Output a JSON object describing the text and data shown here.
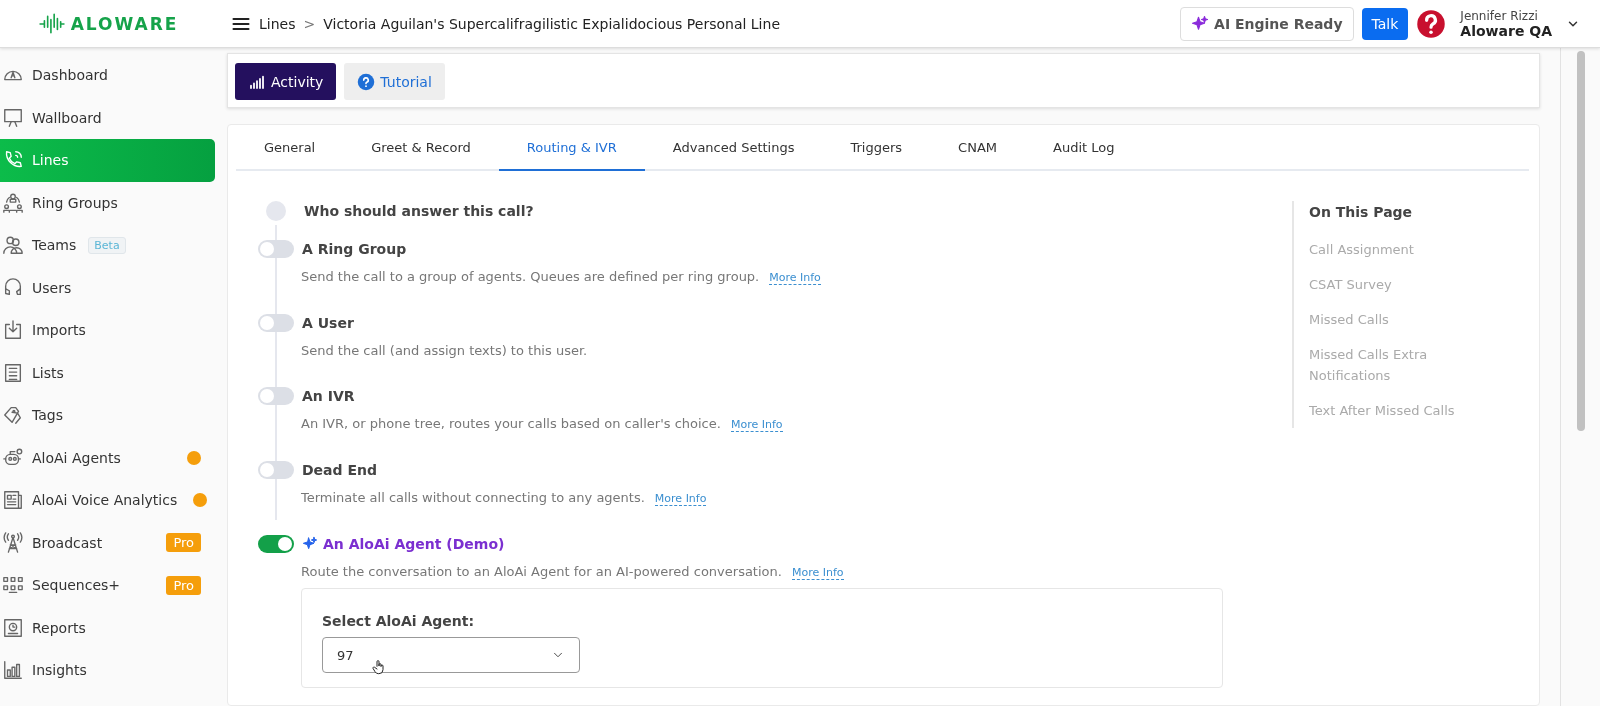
{
  "header": {
    "logo": "ALOWARE",
    "breadcrumb_separator": ">",
    "breadcrumb": [
      {
        "label": "Lines"
      },
      {
        "label": "Victoria Aguilan's Supercalifragilistic Expialidocious Personal Line"
      }
    ],
    "ai_status": "AI Engine Ready",
    "talk_button": "Talk",
    "user": {
      "name": "Jennifer Rizzi",
      "company": "Aloware QA"
    }
  },
  "sidebar": {
    "items": [
      {
        "label": "Dashboard",
        "selected": false
      },
      {
        "label": "Wallboard",
        "selected": false
      },
      {
        "label": "Lines",
        "selected": true
      },
      {
        "label": "Ring Groups",
        "selected": false
      },
      {
        "label": "Teams",
        "selected": false,
        "badge": {
          "kind": "tag",
          "text": "Beta"
        }
      },
      {
        "label": "Users",
        "selected": false
      },
      {
        "label": "Imports",
        "selected": false
      },
      {
        "label": "Lists",
        "selected": false
      },
      {
        "label": "Tags",
        "selected": false
      },
      {
        "label": "AloAi Agents",
        "selected": false,
        "badge": {
          "kind": "dot",
          "color": "#f59e0b"
        }
      },
      {
        "label": "AloAi Voice Analytics",
        "selected": false,
        "badge": {
          "kind": "dot",
          "color": "#f59e0b"
        }
      },
      {
        "label": "Broadcast",
        "selected": false,
        "badge": {
          "kind": "pro",
          "text": "Pro"
        }
      },
      {
        "label": "Sequences+",
        "selected": false,
        "badge": {
          "kind": "pro",
          "text": "Pro"
        }
      },
      {
        "label": "Reports",
        "selected": false
      },
      {
        "label": "Insights",
        "selected": false
      }
    ]
  },
  "toolbar": {
    "buttons": [
      {
        "label": "Activity",
        "kind": "primary"
      },
      {
        "label": "Tutorial",
        "kind": "help"
      }
    ]
  },
  "tabs": [
    {
      "label": "General",
      "selected": false
    },
    {
      "label": "Greet & Record",
      "selected": false
    },
    {
      "label": "Routing & IVR",
      "selected": true
    },
    {
      "label": "Advanced Settings",
      "selected": false
    },
    {
      "label": "Triggers",
      "selected": false
    },
    {
      "label": "CNAM",
      "selected": false
    },
    {
      "label": "Audit Log",
      "selected": false
    }
  ],
  "routing": {
    "question": "Who should answer this call?",
    "options": [
      {
        "title": "A Ring Group",
        "description": "Send the call to a group of agents. Queues are defined per ring group.",
        "link": "More Info",
        "on": false,
        "kind": "plain"
      },
      {
        "title": "A User",
        "description": "Send the call (and assign texts) to this user.",
        "on": false,
        "kind": "plain"
      },
      {
        "title": "An IVR",
        "description": "An IVR, or phone tree, routes your calls based on caller's choice.",
        "link": "More Info",
        "on": false,
        "kind": "plain"
      },
      {
        "title": "Dead End",
        "description": "Terminate all calls without connecting to any agents.",
        "link": "More Info",
        "on": false,
        "kind": "plain"
      },
      {
        "title": "An AloAi Agent (Demo)",
        "description": "Route the conversation to an AloAi Agent for an AI-powered conversation.",
        "link": "More Info",
        "on": true,
        "kind": "ai"
      }
    ],
    "agent_select": {
      "label": "Select AloAi Agent:",
      "value": "97"
    }
  },
  "on_this_page": {
    "title": "On This Page",
    "items": [
      "Call Assignment",
      "CSAT Survey",
      "Missed Calls",
      "Missed Calls Extra Notifications",
      "Text After Missed Calls"
    ]
  }
}
